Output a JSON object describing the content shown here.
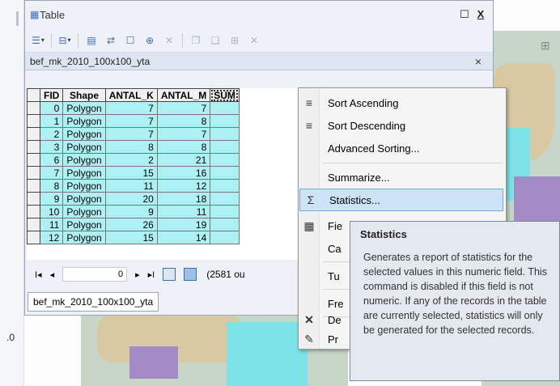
{
  "background": {
    "left_label": ".0",
    "right_toolbar_icon": "map-tool-icon"
  },
  "window": {
    "title": "Table",
    "restore_label": "☐",
    "close_label": "X"
  },
  "toolbar": {
    "icons": [
      "table-options-icon",
      "related-tables-icon",
      "select-by-attributes-icon",
      "switch-selection-icon",
      "clear-selection-icon",
      "zoom-to-selected-icon",
      "delete-selected-icon",
      "copy-icon",
      "paste-icon",
      "add-field-icon",
      "remove-icon"
    ]
  },
  "tab": {
    "name": "bef_mk_2010_100x100_yta",
    "close_label": "×"
  },
  "grid": {
    "columns": [
      "FID",
      "Shape",
      "ANTAL_K",
      "ANTAL_M",
      "SUM"
    ],
    "rows": [
      [
        "0",
        "Polygon",
        "7",
        "7",
        ""
      ],
      [
        "1",
        "Polygon",
        "7",
        "8",
        ""
      ],
      [
        "2",
        "Polygon",
        "7",
        "7",
        ""
      ],
      [
        "3",
        "Polygon",
        "8",
        "8",
        ""
      ],
      [
        "6",
        "Polygon",
        "2",
        "21",
        ""
      ],
      [
        "7",
        "Polygon",
        "15",
        "16",
        ""
      ],
      [
        "8",
        "Polygon",
        "11",
        "12",
        ""
      ],
      [
        "9",
        "Polygon",
        "20",
        "18",
        ""
      ],
      [
        "10",
        "Polygon",
        "9",
        "11",
        ""
      ],
      [
        "11",
        "Polygon",
        "26",
        "19",
        ""
      ],
      [
        "12",
        "Polygon",
        "15",
        "14",
        ""
      ]
    ]
  },
  "navigation": {
    "first_label": "I◂",
    "prev_label": "◂",
    "record_value": "0",
    "next_label": "▸",
    "last_label": "▸I",
    "count_text": "(2581 ou"
  },
  "bottom_tab": {
    "label": "bef_mk_2010_100x100_yta"
  },
  "context_menu": {
    "items": [
      {
        "label": "Sort Ascending",
        "icon": "sort-ascending-icon"
      },
      {
        "label": "Sort Descending",
        "icon": "sort-descending-icon"
      },
      {
        "label": "Advanced Sorting...",
        "icon": ""
      },
      {
        "label": "Summarize...",
        "icon": ""
      },
      {
        "label": "Statistics...",
        "icon": "sigma-icon"
      },
      {
        "label": "Fie",
        "icon": "field-calculator-icon"
      },
      {
        "label": "Ca",
        "icon": ""
      },
      {
        "label": "Tu",
        "icon": ""
      },
      {
        "label": "Fre",
        "icon": ""
      },
      {
        "label": "De",
        "icon": "delete-icon"
      },
      {
        "label": "Pr",
        "icon": "properties-icon"
      }
    ],
    "highlighted": "Statistics..."
  },
  "tooltip": {
    "title": "Statistics",
    "body": "Generates a report of statistics for the selected values in this numeric field. This command is disabled if this field is not numeric. If any of the records in the table are currently selected, statistics will only be generated for the selected records."
  }
}
